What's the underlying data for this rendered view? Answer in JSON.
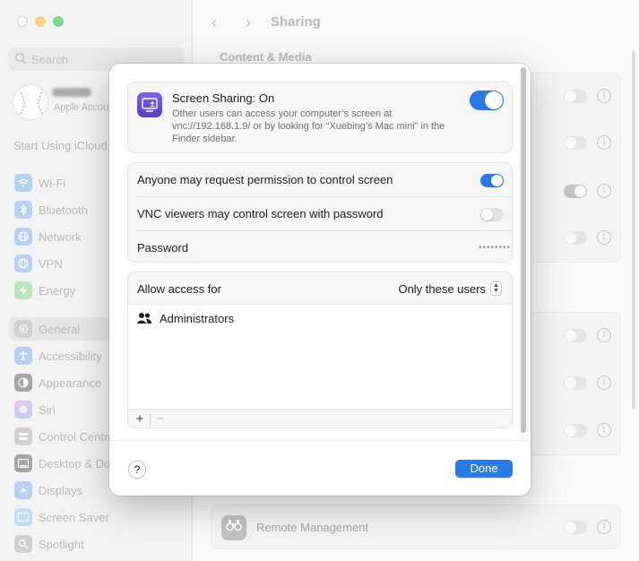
{
  "sidebar": {
    "search_placeholder": "Search",
    "account_subtitle": "Apple Account",
    "start_icloud": "Start Using iCloud",
    "items": [
      {
        "label": "Wi-Fi",
        "color": "#3c8ce6",
        "icon": "wifi-icon"
      },
      {
        "label": "Bluetooth",
        "color": "#3c8ce6",
        "icon": "bluetooth-icon"
      },
      {
        "label": "Network",
        "color": "#3c8ce6",
        "icon": "network-globe-icon"
      },
      {
        "label": "VPN",
        "color": "#3c8ce6",
        "icon": "vpn-globe-icon"
      },
      {
        "label": "Energy",
        "color": "#3cc13c",
        "icon": "energy-bolt-icon"
      },
      {
        "label": "General",
        "color": "#8e8e93",
        "icon": "gear-icon"
      },
      {
        "label": "Accessibility",
        "color": "#2f7be6",
        "icon": "accessibility-icon"
      },
      {
        "label": "Appearance",
        "color": "#1d1d1f",
        "icon": "appearance-icon"
      },
      {
        "label": "Siri",
        "color": "#c04fd0",
        "icon": "siri-icon"
      },
      {
        "label": "Control Centre",
        "color": "#8e8e93",
        "icon": "control-centre-icon"
      },
      {
        "label": "Desktop & Dock",
        "color": "#1d1d1f",
        "icon": "desktop-dock-icon"
      },
      {
        "label": "Displays",
        "color": "#3c8ce6",
        "icon": "displays-sun-icon"
      },
      {
        "label": "Screen Saver",
        "color": "#48b0e8",
        "icon": "screen-saver-icon"
      },
      {
        "label": "Spotlight",
        "color": "#8e8e93",
        "icon": "spotlight-icon"
      }
    ],
    "selected": "General"
  },
  "header": {
    "title": "Sharing",
    "section": "Content & Media",
    "remote_management": "Remote Management"
  },
  "dialog": {
    "screen_sharing_title": "Screen Sharing: On",
    "screen_sharing_desc": "Other users can access your computer’s screen at vnc://192.168.1.9/ or by looking for “Xuebing’s Mac mini” in the Finder sidebar.",
    "screen_sharing_enabled": true,
    "options": [
      {
        "label": "Anyone may request permission to control screen",
        "enabled": true
      },
      {
        "label": "VNC viewers may control screen with password",
        "enabled": false
      }
    ],
    "password_label": "Password",
    "password_value": "••••••••",
    "allow_access_label": "Allow access for",
    "allow_access_value": "Only these users",
    "users": [
      "Administrators"
    ],
    "add_label": "+",
    "remove_label": "−",
    "help_label": "?",
    "done_label": "Done"
  },
  "colors": {
    "accent": "#2a7ae4"
  }
}
